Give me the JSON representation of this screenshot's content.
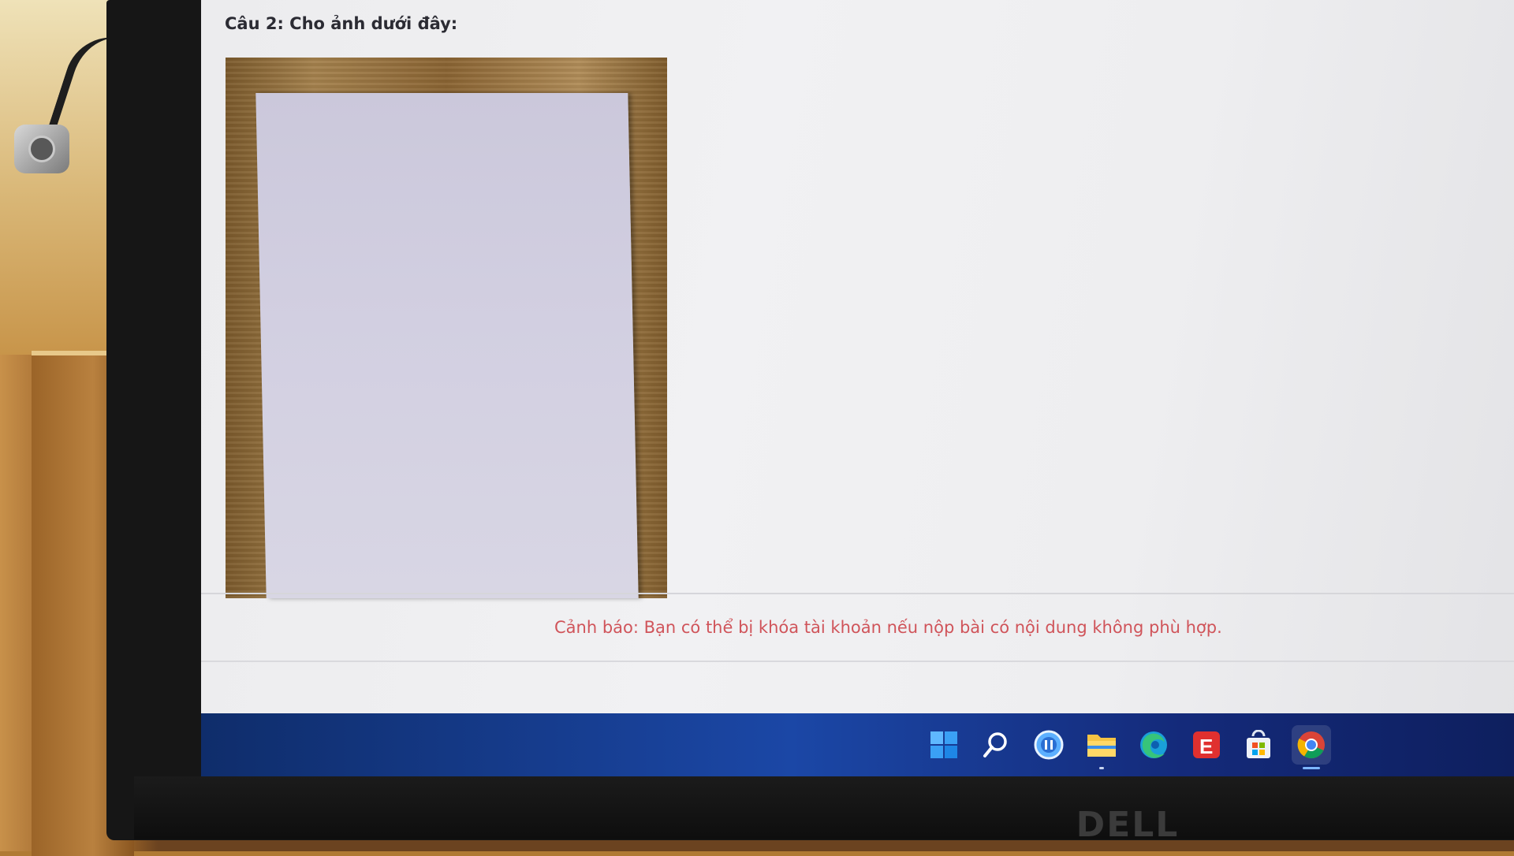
{
  "question": {
    "title": "Câu 2:  Cho ảnh dưới đây:"
  },
  "warning": {
    "text": "Cảnh báo: Bạn có thể bị khóa tài khoản nếu nộp bài có nội dung không phù hợp."
  },
  "taskbar": {
    "icons": [
      "windows-start-icon",
      "search-icon",
      "meet-icon",
      "file-explorer-icon",
      "edge-icon",
      "e-app-icon",
      "store-icon",
      "chrome-icon"
    ],
    "active_icon": "chrome-icon"
  },
  "monitor": {
    "brand": "DELL"
  },
  "colors": {
    "warning": "#d0545a",
    "taskbar": "#1b47a6",
    "screen_bg": "#eeeef0"
  }
}
